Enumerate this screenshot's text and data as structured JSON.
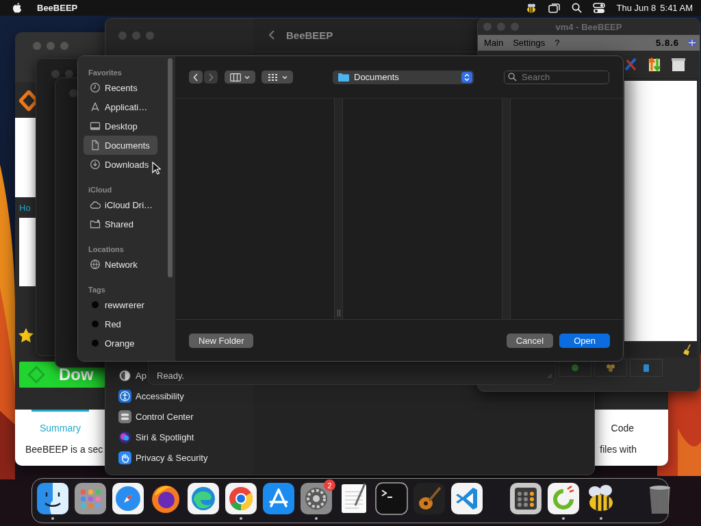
{
  "menu_bar": {
    "app_name": "BeeBEEP",
    "date": "Thu Jun 8",
    "time": "5:41 AM"
  },
  "browser_window": {
    "link": "Ho",
    "download_button": "Dow",
    "tabs": [
      {
        "label": "Summary",
        "selected": true
      },
      {
        "label": "Code",
        "selected": false
      }
    ],
    "description_start": "BeeBEEP is a sec",
    "description_end": "files with"
  },
  "settings_window": {
    "title": "BeeBEEP",
    "sidebar_items": [
      {
        "label": "Ap",
        "kind": "appearance",
        "selected": false
      },
      {
        "label": "Accessibility",
        "kind": "accessibility",
        "selected": false
      },
      {
        "label": "Control Center",
        "kind": "control-center",
        "selected": false
      },
      {
        "label": "Siri & Spotlight",
        "kind": "siri",
        "selected": false
      },
      {
        "label": "Privacy & Security",
        "kind": "privacy",
        "selected": false
      }
    ]
  },
  "chat_window": {
    "title": "vm4 - BeeBEEP",
    "menu": [
      "Main",
      "Settings",
      "?"
    ],
    "version": "5.8.6"
  },
  "main_window": {
    "status": "Ready."
  },
  "open_dialog": {
    "sidebar": [
      {
        "heading": "Favorites",
        "items": [
          {
            "label": "Recents",
            "kind": "recents",
            "selected": false
          },
          {
            "label": "Applicati…",
            "kind": "applications",
            "selected": false
          },
          {
            "label": "Desktop",
            "kind": "desktop",
            "selected": false
          },
          {
            "label": "Documents",
            "kind": "documents",
            "selected": true
          },
          {
            "label": "Downloads",
            "kind": "downloads",
            "selected": false
          }
        ]
      },
      {
        "heading": "iCloud",
        "items": [
          {
            "label": "iCloud Dri…",
            "kind": "icloud",
            "selected": false
          },
          {
            "label": "Shared",
            "kind": "shared",
            "selected": false
          }
        ]
      },
      {
        "heading": "Locations",
        "items": [
          {
            "label": "Network",
            "kind": "network",
            "selected": false
          }
        ]
      },
      {
        "heading": "Tags",
        "items": [
          {
            "label": "rewwrerer",
            "kind": "tag",
            "selected": false
          },
          {
            "label": "Red",
            "kind": "tag",
            "selected": false
          },
          {
            "label": "Orange",
            "kind": "tag",
            "selected": false
          }
        ]
      }
    ],
    "path": "Documents",
    "search": {
      "placeholder": "Search"
    },
    "buttons": [
      {
        "label": "New Folder",
        "kind": "secondary"
      },
      {
        "label": "Cancel",
        "kind": "secondary"
      },
      {
        "label": "Open",
        "kind": "primary"
      }
    ]
  },
  "dock": {
    "items": [
      {
        "kind": "finder",
        "running": true
      },
      {
        "kind": "launchpad",
        "running": false
      },
      {
        "kind": "safari",
        "running": false
      },
      {
        "kind": "firefox",
        "running": false
      },
      {
        "kind": "edge",
        "running": false
      },
      {
        "kind": "chrome",
        "running": true
      },
      {
        "kind": "appstore",
        "running": false
      },
      {
        "kind": "settings",
        "running": true,
        "badge": "2"
      },
      {
        "kind": "textedit",
        "running": false
      },
      {
        "kind": "terminal",
        "running": false
      },
      {
        "kind": "garageband",
        "running": false
      },
      {
        "kind": "vscode",
        "running": false
      },
      {
        "kind": "separator"
      },
      {
        "kind": "calculator",
        "running": false
      },
      {
        "kind": "ccleaner",
        "running": true
      },
      {
        "kind": "beebeep",
        "running": true
      },
      {
        "kind": "separator"
      },
      {
        "kind": "trash",
        "running": false
      }
    ]
  }
}
